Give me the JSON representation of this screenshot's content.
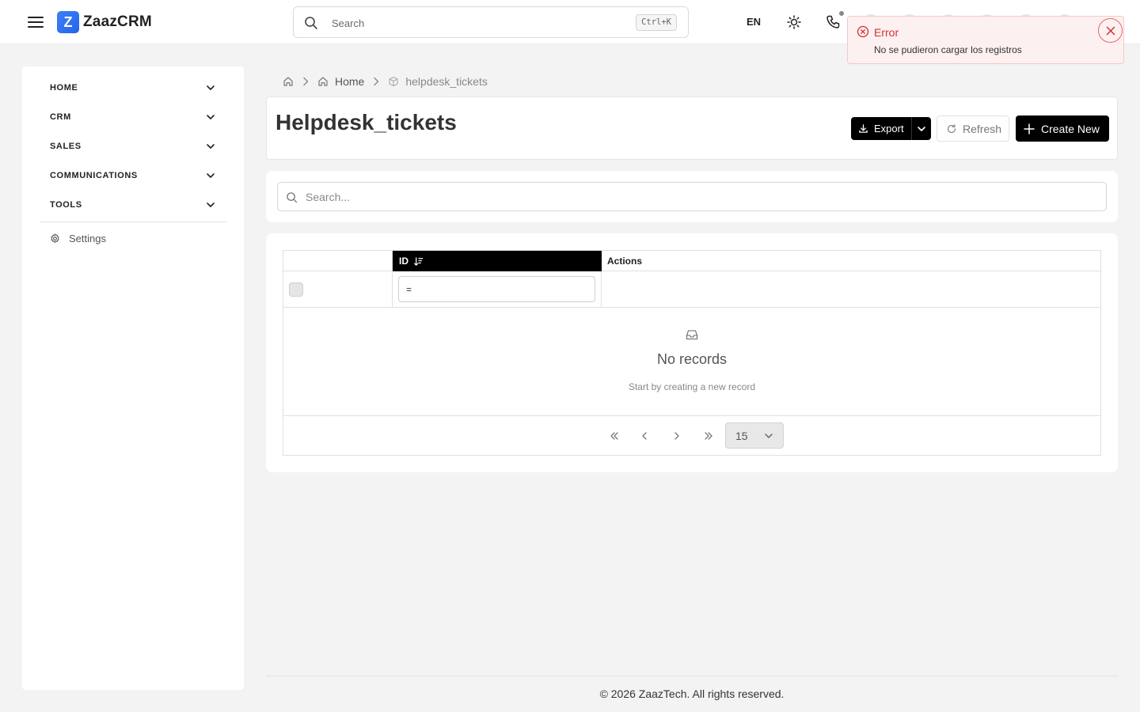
{
  "app": {
    "logo_letter": "Z",
    "name": "ZaazCRM"
  },
  "topbar": {
    "search_placeholder": "Search",
    "search_shortcut": "Ctrl+K",
    "language": "EN"
  },
  "sidebar": {
    "items": [
      {
        "label": "HOME"
      },
      {
        "label": "CRM"
      },
      {
        "label": "SALES"
      },
      {
        "label": "COMMUNICATIONS"
      },
      {
        "label": "TOOLS"
      }
    ],
    "settings_label": "Settings"
  },
  "breadcrumb": {
    "home": "Home",
    "current": "helpdesk_tickets"
  },
  "page": {
    "title": "Helpdesk_tickets",
    "export_label": "Export",
    "refresh_label": "Refresh",
    "create_label": "Create New"
  },
  "list": {
    "search_placeholder": "Search...",
    "columns": {
      "id": "ID",
      "actions": "Actions"
    },
    "id_filter_value": "=",
    "empty_title": "No records",
    "empty_subtitle": "Start by creating a new record",
    "page_size": "15"
  },
  "footer": {
    "text": "© 2026 ZaazTech. All rights reserved."
  },
  "toast": {
    "title": "Error",
    "message": "No se pudieron cargar los registros",
    "color": "#d32f2f"
  }
}
